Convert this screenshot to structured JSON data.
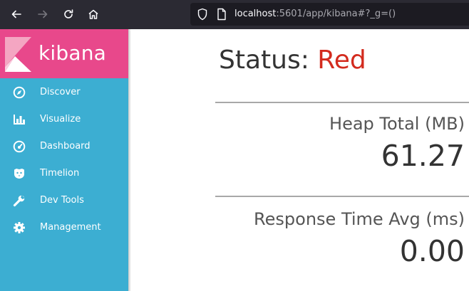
{
  "browser": {
    "back_icon": "arrow-left-icon",
    "forward_icon": "arrow-right-icon",
    "reload_icon": "reload-icon",
    "home_icon": "home-icon",
    "url_host": "localhost",
    "url_rest": ":5601/app/kibana#?_g=()"
  },
  "sidebar": {
    "logo_text": "kibana",
    "items": [
      {
        "label": "Discover",
        "icon": "compass-icon"
      },
      {
        "label": "Visualize",
        "icon": "bar-chart-icon"
      },
      {
        "label": "Dashboard",
        "icon": "gauge-icon"
      },
      {
        "label": "Timelion",
        "icon": "timelion-icon"
      },
      {
        "label": "Dev Tools",
        "icon": "wrench-icon"
      },
      {
        "label": "Management",
        "icon": "gear-icon"
      }
    ]
  },
  "status": {
    "label": "Status:",
    "value": "Red"
  },
  "metrics": [
    {
      "title": "Heap Total (MB)",
      "value": "61.27"
    },
    {
      "title": "Response Time Avg (ms)",
      "value": "0.00"
    }
  ],
  "colors": {
    "sidebar": "#3caed2",
    "logo_bg": "#e8488b",
    "status_red": "#d32b1e",
    "browser_toolbar": "#2b2a33"
  }
}
